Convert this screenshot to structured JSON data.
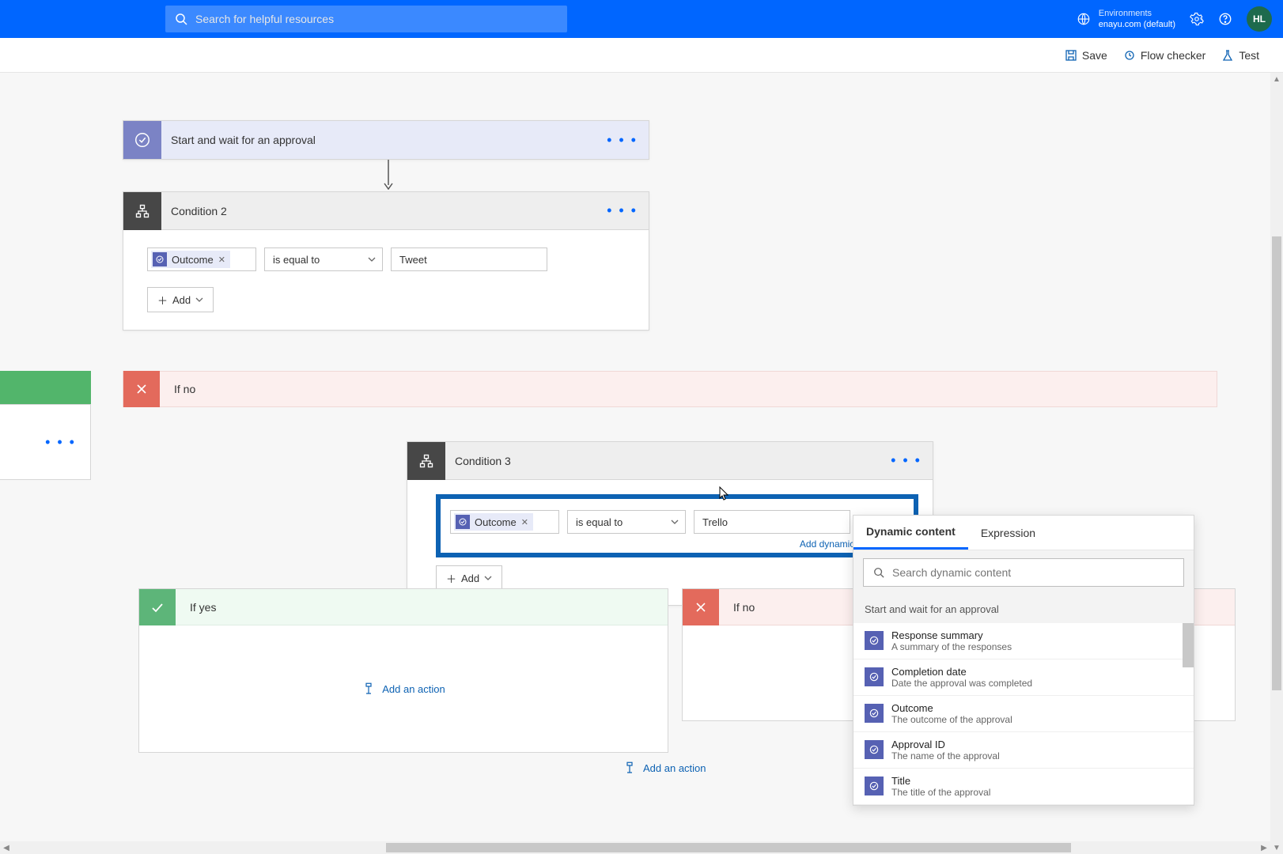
{
  "topbar": {
    "search_placeholder": "Search for helpful resources",
    "env_label": "Environments",
    "env_value": "enayu.com (default)",
    "avatar_initials": "HL"
  },
  "toolbar": {
    "save": "Save",
    "flow_checker": "Flow checker",
    "test": "Test"
  },
  "approval": {
    "title": "Start and wait for an approval"
  },
  "cond2": {
    "title": "Condition 2",
    "chip_label": "Outcome",
    "operator": "is equal to",
    "value": "Tweet",
    "add_label": "Add"
  },
  "branch_left": {
    "more": "• • •"
  },
  "ifno_banner": {
    "label": "If no"
  },
  "cond3": {
    "title": "Condition 3",
    "chip_label": "Outcome",
    "operator": "is equal to",
    "value": "Trello",
    "dyn_link": "Add dynamic content",
    "add_label": "Add"
  },
  "ifyes": {
    "label": "If yes",
    "add_action": "Add an action"
  },
  "ifno2": {
    "label": "If no"
  },
  "bottom": {
    "add_action": "Add an action"
  },
  "dynpane": {
    "tab_dynamic": "Dynamic content",
    "tab_expression": "Expression",
    "search_placeholder": "Search dynamic content",
    "group": "Start and wait for an approval",
    "items": [
      {
        "t1": "Response summary",
        "t2": "A summary of the responses"
      },
      {
        "t1": "Completion date",
        "t2": "Date the approval was completed"
      },
      {
        "t1": "Outcome",
        "t2": "The outcome of the approval"
      },
      {
        "t1": "Approval ID",
        "t2": "The name of the approval"
      },
      {
        "t1": "Title",
        "t2": "The title of the approval"
      }
    ]
  }
}
